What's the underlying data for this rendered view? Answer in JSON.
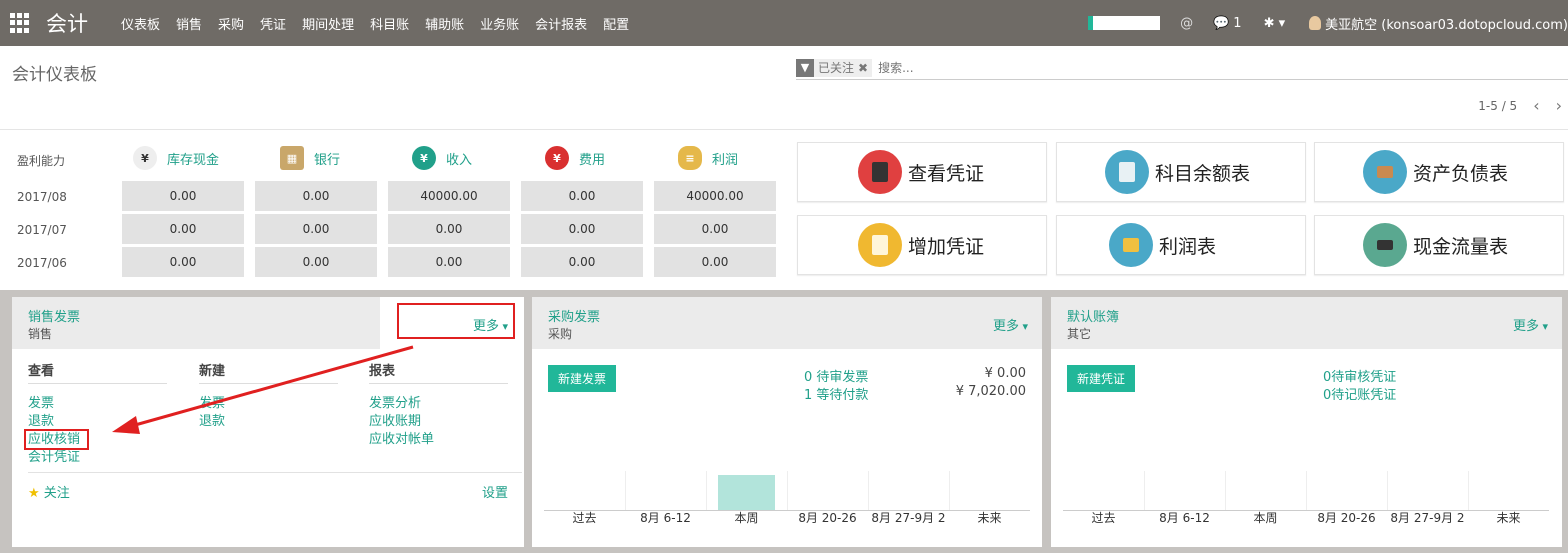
{
  "nav": {
    "app_name": "会计",
    "menu": [
      "仪表板",
      "销售",
      "采购",
      "凭证",
      "期间处理",
      "科目账",
      "辅助账",
      "业务账",
      "会计报表",
      "配置"
    ],
    "chat_count": "1",
    "user": "美亚航空 (konsoar03.dotopcloud.com)"
  },
  "control": {
    "title": "会计仪表板",
    "facet": "已关注",
    "search_placeholder": "搜索...",
    "pager": "1-5 / 5"
  },
  "profit": {
    "label": "盈利能力",
    "columns": [
      "库存现金",
      "银行",
      "收入",
      "费用",
      "利润"
    ],
    "rows": [
      {
        "period": "2017/08",
        "values": [
          "0.00",
          "0.00",
          "40000.00",
          "0.00",
          "40000.00"
        ]
      },
      {
        "period": "2017/07",
        "values": [
          "0.00",
          "0.00",
          "0.00",
          "0.00",
          "0.00"
        ]
      },
      {
        "period": "2017/06",
        "values": [
          "0.00",
          "0.00",
          "0.00",
          "0.00",
          "0.00"
        ]
      }
    ]
  },
  "shortcuts": [
    "查看凭证",
    "科目余额表",
    "资产负债表",
    "增加凭证",
    "利润表",
    "现金流量表"
  ],
  "sales": {
    "title": "销售发票",
    "subtitle": "销售",
    "more": "更多",
    "view_h": "查看",
    "new_h": "新建",
    "report_h": "报表",
    "view": [
      "发票",
      "退款",
      "应收核销",
      "会计凭证"
    ],
    "new": [
      "发票",
      "退款"
    ],
    "reports": [
      "发票分析",
      "应收账期",
      "应收对帐单"
    ],
    "follow": "关注",
    "settings": "设置"
  },
  "purchase": {
    "title": "采购发票",
    "subtitle": "采购",
    "more": "更多",
    "button": "新建发票",
    "stat1": "0 待审发票",
    "stat2": "1 等待付款",
    "amt1": "¥ 0.00",
    "amt2": "¥ 7,020.00",
    "xticks": [
      "过去",
      "8月 6-12",
      "本周",
      "8月 20-26",
      "8月 27-9月 2",
      "未来"
    ]
  },
  "journal": {
    "title": "默认账簿",
    "subtitle": "其它",
    "more": "更多",
    "button": "新建凭证",
    "stat1": "0待审核凭证",
    "stat2": "0待记账凭证",
    "xticks": [
      "过去",
      "8月 6-12",
      "本周",
      "8月 20-26",
      "8月 27-9月 2",
      "未来"
    ]
  },
  "chart_data": [
    {
      "type": "bar",
      "categories": [
        "过去",
        "8月 6-12",
        "本周",
        "8月 20-26",
        "8月 27-9月 2",
        "未来"
      ],
      "values": [
        0,
        0,
        7020,
        0,
        0,
        0
      ],
      "ylabel": "",
      "xlabel": "",
      "title": ""
    },
    {
      "type": "bar",
      "categories": [
        "过去",
        "8月 6-12",
        "本周",
        "8月 20-26",
        "8月 27-9月 2",
        "未来"
      ],
      "values": [
        0,
        0,
        0,
        0,
        0,
        0
      ],
      "ylabel": "",
      "xlabel": "",
      "title": ""
    }
  ]
}
